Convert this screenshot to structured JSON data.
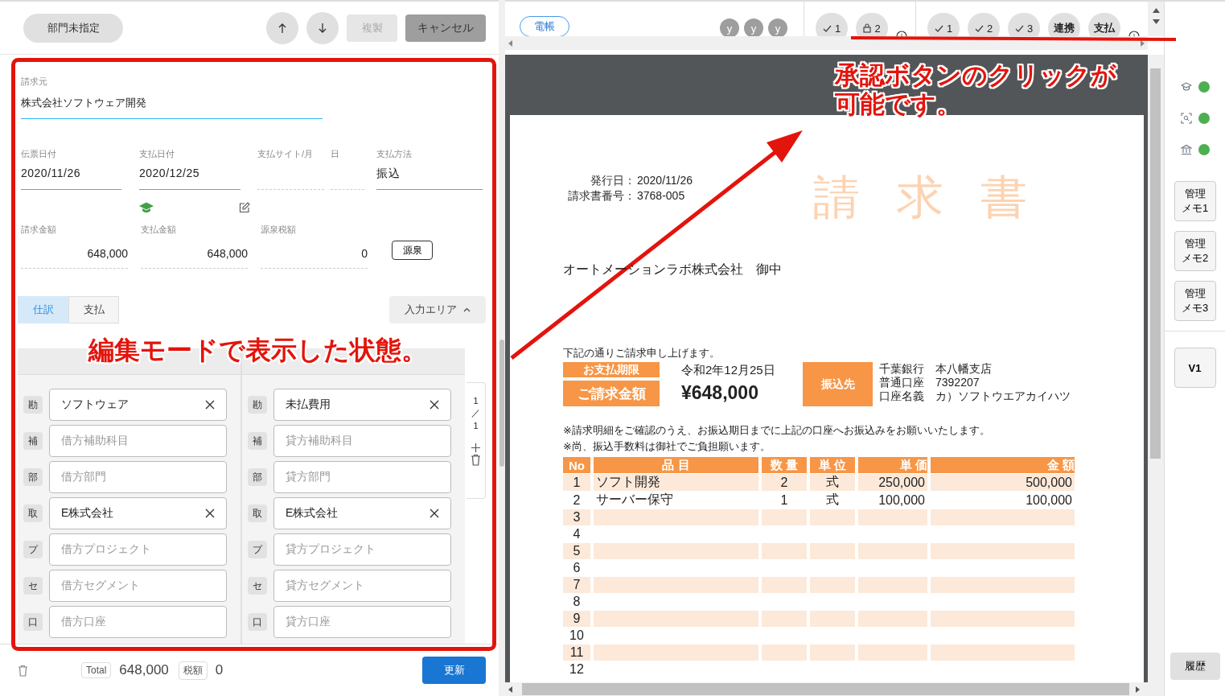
{
  "left_panel": {
    "toolbar": {
      "department_button": "部門未指定",
      "copy_button": {
        "label": "複製",
        "disabled": true
      },
      "cancel_button": "キャンセル"
    },
    "form": {
      "billing_source": {
        "label": "請求元",
        "value": "株式会社ソフトウェア開発"
      },
      "fields": [
        {
          "label": "伝票日付",
          "value": "2020/11/26"
        },
        {
          "label": "支払日付",
          "value": "2020/12/25"
        },
        {
          "label": "支払サイト/月"
        },
        {
          "label": "日"
        },
        {
          "label": "支払方法",
          "value": "振込"
        }
      ],
      "amounts": [
        {
          "label": "請求金額",
          "value": "648,000"
        },
        {
          "label": "支払金額",
          "value": "648,000"
        },
        {
          "label": "源泉税額",
          "value": "0"
        }
      ],
      "withholding_button": "源泉"
    },
    "tabs": [
      {
        "label": "仕訳",
        "selected": true
      },
      {
        "label": "支払",
        "selected": false
      }
    ],
    "input_area_button": "入力エリア",
    "journal": {
      "debit": [
        {
          "badge": "勘",
          "value": "ソフトウェア"
        },
        {
          "badge": "補",
          "placeholder": "借方補助科目"
        },
        {
          "badge": "部",
          "placeholder": "借方部門"
        },
        {
          "badge": "取",
          "value": "E株式会社"
        },
        {
          "badge": "プ",
          "placeholder": "借方プロジェクト"
        },
        {
          "badge": "セ",
          "placeholder": "借方セグメント"
        },
        {
          "badge": "口",
          "placeholder": "借方口座"
        }
      ],
      "credit": [
        {
          "badge": "勘",
          "value": "未払費用"
        },
        {
          "badge": "補",
          "placeholder": "貸方補助科目"
        },
        {
          "badge": "部",
          "placeholder": "貸方部門"
        },
        {
          "badge": "取",
          "value": "E株式会社"
        },
        {
          "badge": "プ",
          "placeholder": "貸方プロジェクト"
        },
        {
          "badge": "セ",
          "placeholder": "貸方セグメント"
        },
        {
          "badge": "口",
          "placeholder": "貸方口座"
        }
      ]
    },
    "pager": {
      "current": "1",
      "separator": "／",
      "total": "1"
    },
    "footer": {
      "total_label": "Total",
      "total": "648,000",
      "tax_label": "税額",
      "tax": "0",
      "update_button": "更新"
    }
  },
  "top_bar": {
    "tag": "電帳",
    "avatars": [
      "y",
      "y",
      "y"
    ],
    "group_1": [
      {
        "kind": "check",
        "label": "1"
      },
      {
        "kind": "lock",
        "label": "2"
      }
    ],
    "group_2": [
      {
        "kind": "check",
        "label": "1"
      },
      {
        "kind": "check",
        "label": "2"
      },
      {
        "kind": "check",
        "label": "3"
      },
      {
        "kind": "text",
        "label": "連携"
      },
      {
        "kind": "text",
        "label": "支払"
      }
    ]
  },
  "invoice": {
    "meta": [
      {
        "label": "発行日：",
        "value": "2020/11/26"
      },
      {
        "label": "請求書番号：",
        "value": "3768-005"
      }
    ],
    "title": "請求書",
    "recipient": "オートメーションラボ株式会社　御中",
    "intro": "下記の通りご請求申し上げます。",
    "due_label": "お支払期限",
    "due_date": "令和2年12月25日",
    "amount_label": "ご請求金額",
    "amount": "¥648,000",
    "bank_label": "振込先",
    "bank_lines": [
      "千葉銀行　本八幡支店",
      "普通口座　7392207",
      "口座名義　カ）ソフトウエアカイハツ"
    ],
    "notes": [
      "※請求明細をご確認のうえ、お振込期日までに上記の口座へお振込みをお願いいたします。",
      "※尚、振込手数料は御社でご負担願います。"
    ],
    "columns": [
      "No",
      "品 目",
      "数 量",
      "単 位",
      "単 価",
      "金 額"
    ],
    "rows": [
      [
        "1",
        "ソフト開発",
        "2",
        "式",
        "250,000",
        "500,000"
      ],
      [
        "2",
        "サーバー保守",
        "1",
        "式",
        "100,000",
        "100,000"
      ],
      [
        "3"
      ],
      [
        "4"
      ],
      [
        "5"
      ],
      [
        "6"
      ],
      [
        "7"
      ],
      [
        "8"
      ],
      [
        "9"
      ],
      [
        "10"
      ],
      [
        "11"
      ],
      [
        "12"
      ]
    ]
  },
  "sidebar": {
    "statuses": [
      {
        "kind": "cap",
        "on": true
      },
      {
        "kind": "scan",
        "on": true
      },
      {
        "kind": "bank",
        "on": true
      }
    ],
    "memo_buttons": [
      "管理メモ1",
      "管理メモ2",
      "管理メモ3"
    ],
    "version_button": "V1",
    "history_button": "履歴"
  },
  "annotations": {
    "left_caption": "編集モードで表示した状態。",
    "right_caption": "承認ボタンのクリックが可能です。"
  }
}
